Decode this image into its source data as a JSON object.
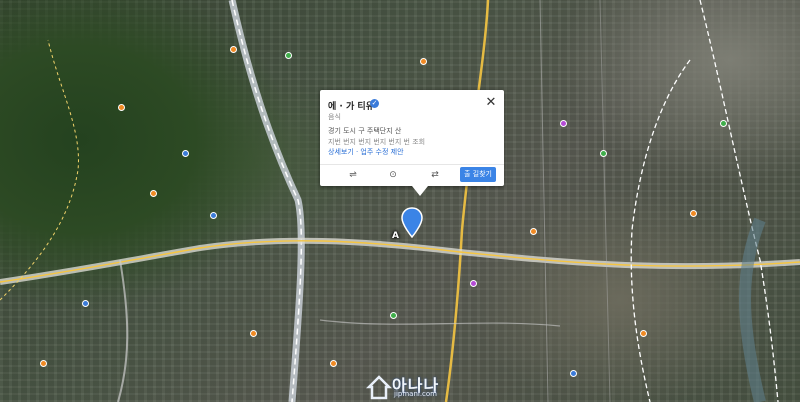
{
  "popup": {
    "name": "에 · 가 티유",
    "category": "음식",
    "address": "경기 도시 구 주택단지 산",
    "jibun": "지번 번지 번지 번지 번지 번 조회",
    "link": "상세보기 · 업주 수정 제안",
    "route_label": "출 길찾기",
    "close_icon": "close-icon",
    "verified_icon": "verified-check-icon"
  },
  "marker": {
    "label": "A",
    "icon": "location-pin-icon",
    "color": "#3b84e6"
  },
  "watermark": {
    "text": "아나나",
    "sub": "jipmani.com",
    "icon": "house-logo"
  },
  "poi_colors": {
    "food": "#f08a24",
    "park": "#3fae4a",
    "public": "#3b7bd9",
    "shop": "#b54bd6"
  },
  "road_colors": {
    "highway": "#ffffff",
    "arterial": "#f5c542",
    "boundary": "#e8e8e8"
  }
}
